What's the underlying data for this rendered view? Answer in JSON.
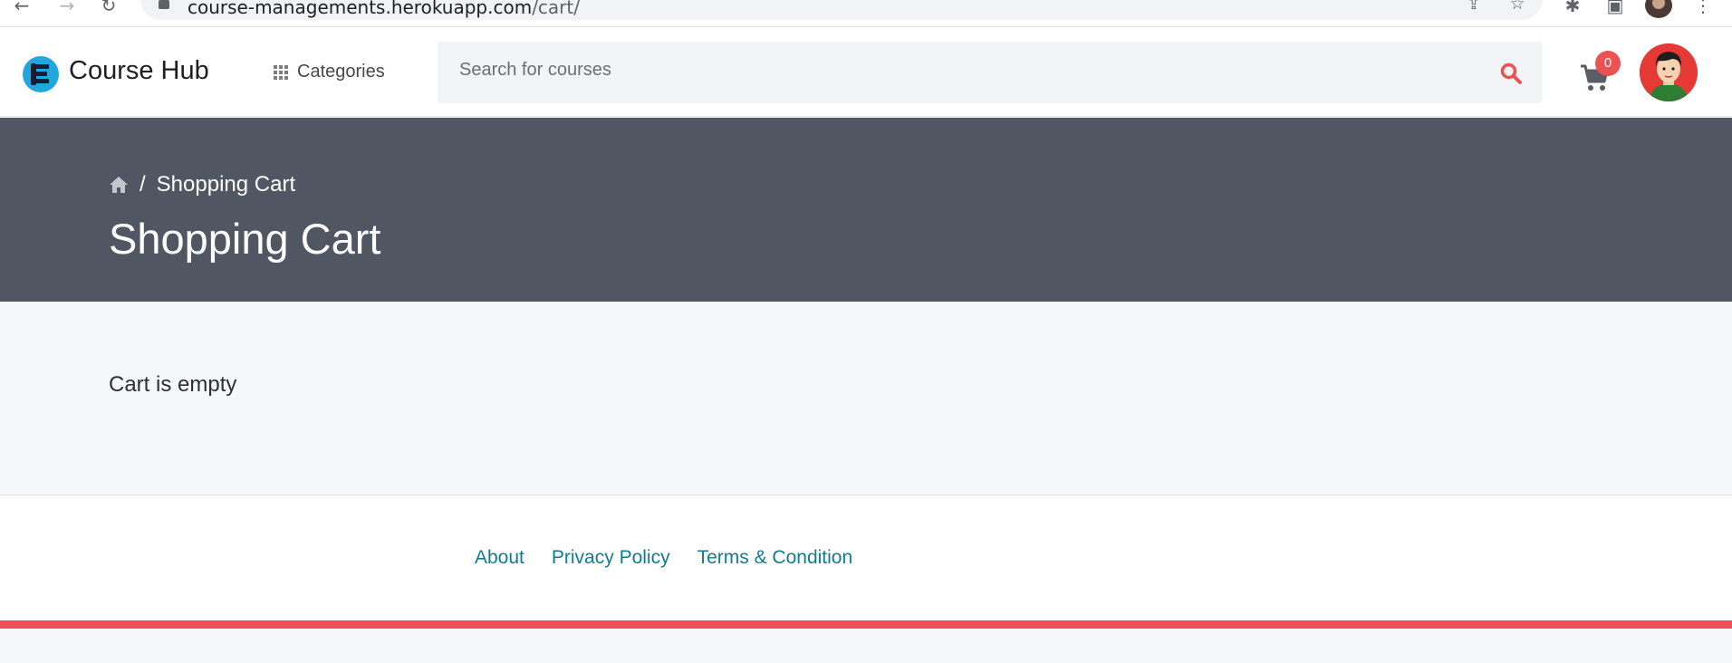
{
  "browser": {
    "url_host": "course-managements.herokuapp.com",
    "url_path": "/cart/",
    "icons": [
      "back-icon",
      "forward-icon",
      "reload-icon",
      "lock-icon",
      "share-icon",
      "star-icon",
      "extensions-icon",
      "sidepanel-icon",
      "profile-avatar",
      "menu-icon"
    ]
  },
  "header": {
    "brand": "Course Hub",
    "categories_label": "Categories",
    "search_placeholder": "Search for courses",
    "cart_count": "0"
  },
  "hero": {
    "breadcrumb_current": "Shopping Cart",
    "breadcrumb_separator": "/",
    "title": "Shopping Cart"
  },
  "main": {
    "empty_message": "Cart is empty"
  },
  "footer": {
    "links": [
      "About",
      "Privacy Policy",
      "Terms & Condition"
    ]
  },
  "colors": {
    "accent": "#ec5252",
    "hero_bg": "#505763",
    "link": "#0f7c90",
    "logo": "#21a6dd"
  }
}
